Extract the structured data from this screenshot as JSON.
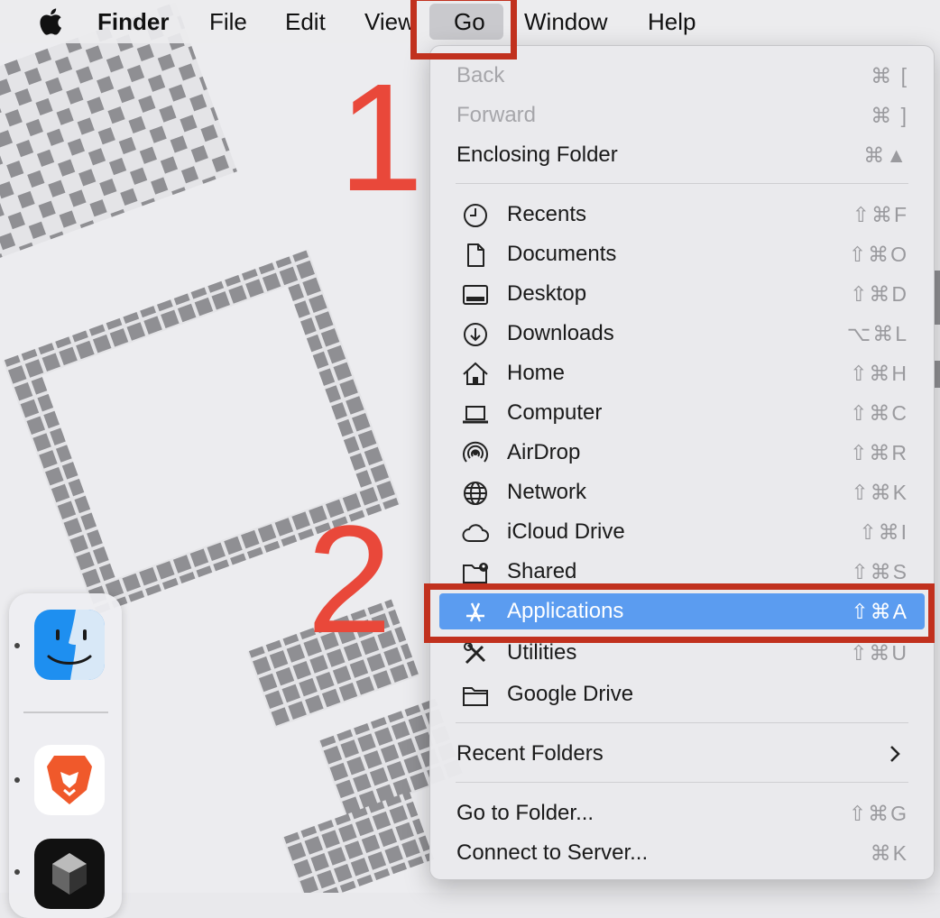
{
  "menubar": {
    "finder_label": "Finder",
    "file_label": "File",
    "edit_label": "Edit",
    "view_label": "View",
    "go_label": "Go",
    "window_label": "Window",
    "help_label": "Help"
  },
  "go_menu": {
    "back": {
      "label": "Back",
      "shortcut": "⌘ ["
    },
    "forward": {
      "label": "Forward",
      "shortcut": "⌘ ]"
    },
    "enclosing_folder": {
      "label": "Enclosing Folder",
      "shortcut": "⌘▲"
    },
    "recents": {
      "label": "Recents",
      "shortcut": "⇧⌘F",
      "icon": "clock-icon"
    },
    "documents": {
      "label": "Documents",
      "shortcut": "⇧⌘O",
      "icon": "document-icon"
    },
    "desktop": {
      "label": "Desktop",
      "shortcut": "⇧⌘D",
      "icon": "desktop-icon"
    },
    "downloads": {
      "label": "Downloads",
      "shortcut": "⌥⌘L",
      "icon": "download-icon"
    },
    "home": {
      "label": "Home",
      "shortcut": "⇧⌘H",
      "icon": "home-icon"
    },
    "computer": {
      "label": "Computer",
      "shortcut": "⇧⌘C",
      "icon": "laptop-icon"
    },
    "airdrop": {
      "label": "AirDrop",
      "shortcut": "⇧⌘R",
      "icon": "airdrop-icon"
    },
    "network": {
      "label": "Network",
      "shortcut": "⇧⌘K",
      "icon": "globe-icon"
    },
    "icloud_drive": {
      "label": "iCloud Drive",
      "shortcut": "⇧⌘I",
      "icon": "cloud-icon"
    },
    "shared": {
      "label": "Shared",
      "shortcut": "⇧⌘S",
      "icon": "shared-folder-icon"
    },
    "applications": {
      "label": "Applications",
      "shortcut": "⇧⌘A",
      "icon": "app-store-icon"
    },
    "utilities": {
      "label": "Utilities",
      "shortcut": "⇧⌘U",
      "icon": "tools-icon"
    },
    "google_drive": {
      "label": "Google Drive",
      "shortcut": "",
      "icon": "folder-icon"
    },
    "recent_folders": {
      "label": "Recent Folders"
    },
    "go_to_folder": {
      "label": "Go to Folder...",
      "shortcut": "⇧⌘G"
    },
    "connect_to_server": {
      "label": "Connect to Server...",
      "shortcut": "⌘K"
    }
  },
  "annotations": {
    "step1": "1",
    "step2": "2",
    "color": "#c1311e"
  },
  "dock": {
    "apps": [
      "finder-icon",
      "brave-browser-icon",
      "dark-app-icon"
    ]
  },
  "colors": {
    "selection": "#5b9cf0",
    "menu_bg": "#e9e9ec"
  }
}
